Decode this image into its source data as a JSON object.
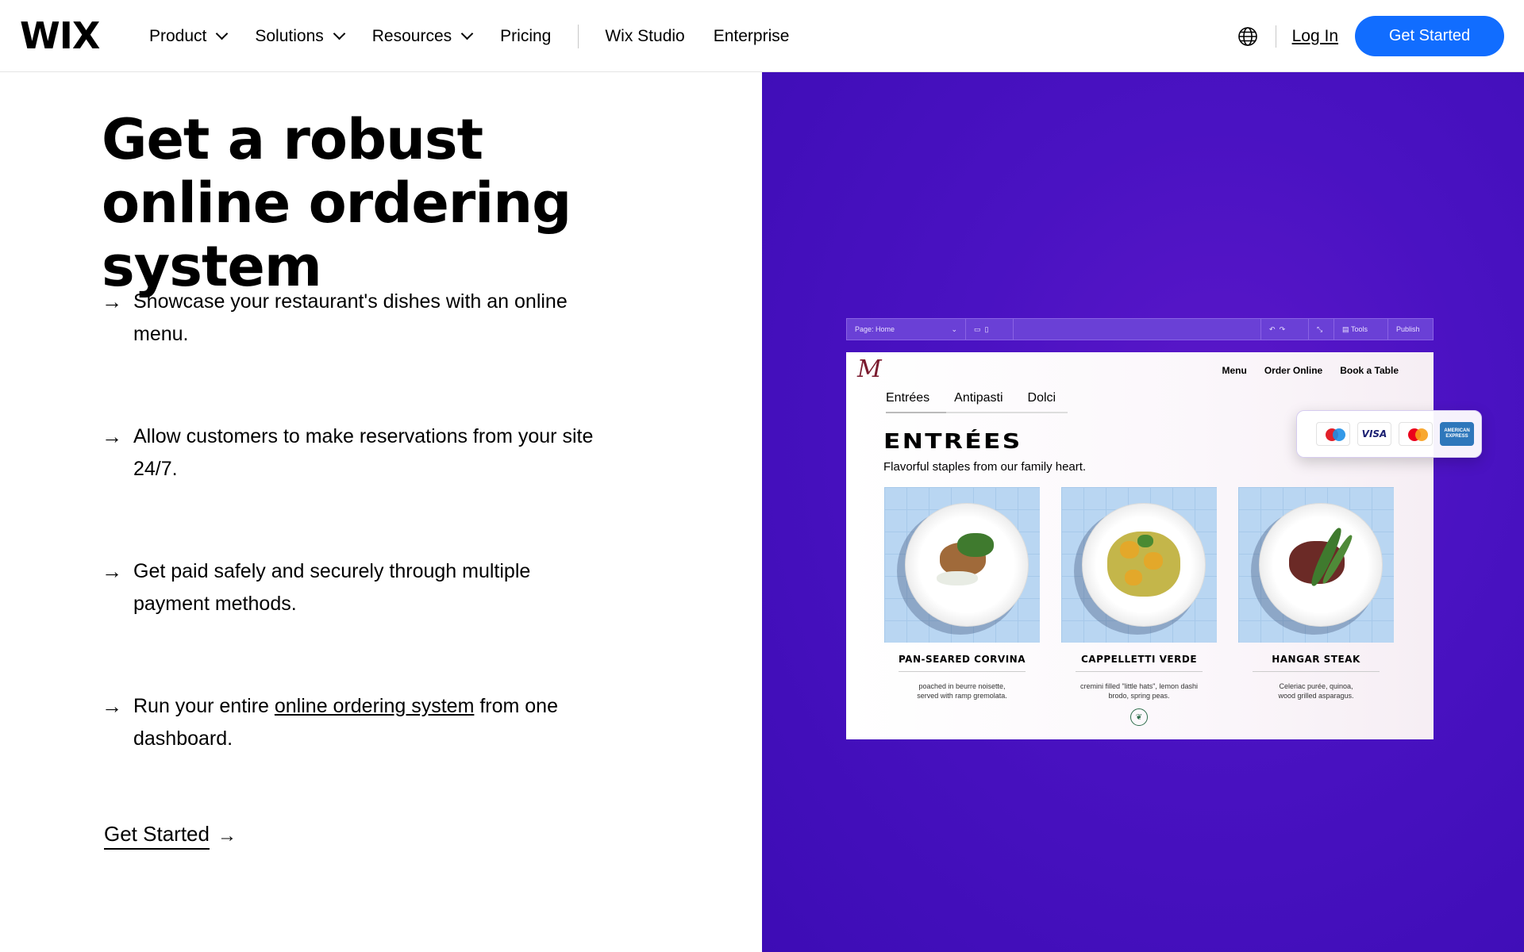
{
  "header": {
    "logo": "WIX",
    "nav": [
      {
        "label": "Product",
        "dropdown": true
      },
      {
        "label": "Solutions",
        "dropdown": true
      },
      {
        "label": "Resources",
        "dropdown": true
      },
      {
        "label": "Pricing",
        "dropdown": false
      }
    ],
    "nav_secondary": [
      {
        "label": "Wix Studio"
      },
      {
        "label": "Enterprise"
      }
    ],
    "login_label": "Log In",
    "cta_label": "Get Started"
  },
  "hero": {
    "title": "Get a robust online ordering system",
    "features": [
      {
        "text": "Showcase your restaurant's dishes with an online menu."
      },
      {
        "text": "Allow customers to make reservations from your site 24/7."
      },
      {
        "text": "Get paid safely and securely through multiple payment methods."
      },
      {
        "before": "Run your entire ",
        "link": "online ordering system",
        "after": " from one dashboard."
      }
    ],
    "cta_link": "Get Started"
  },
  "preview": {
    "editor_bar": {
      "page_label": "Page: Home",
      "tools_label": "Tools",
      "publish_label": "Publish"
    },
    "site": {
      "logo": "M",
      "menu": [
        "Menu",
        "Order Online",
        "Book a Table"
      ],
      "tabs": [
        "Entrées",
        "Antipasti",
        "Dolci"
      ],
      "section_title": "ENTRÉES",
      "section_subtitle": "Flavorful staples from our family heart.",
      "dishes": [
        {
          "name": "PAN-SEARED CORVINA",
          "desc": "poached in beurre noisette, served with ramp gremolata."
        },
        {
          "name": "CAPPELLETTI VERDE",
          "desc": "cremini filled \"little hats\", lemon dashi brodo, spring peas."
        },
        {
          "name": "HANGAR STEAK",
          "desc": "Celeriac purée, quinoa, wood grilled asparagus."
        }
      ]
    },
    "payments": {
      "visa": "VISA",
      "amex": "AMERICAN EXPRESS"
    }
  },
  "colors": {
    "accent": "#116dff",
    "panel": "#4a12c2"
  }
}
